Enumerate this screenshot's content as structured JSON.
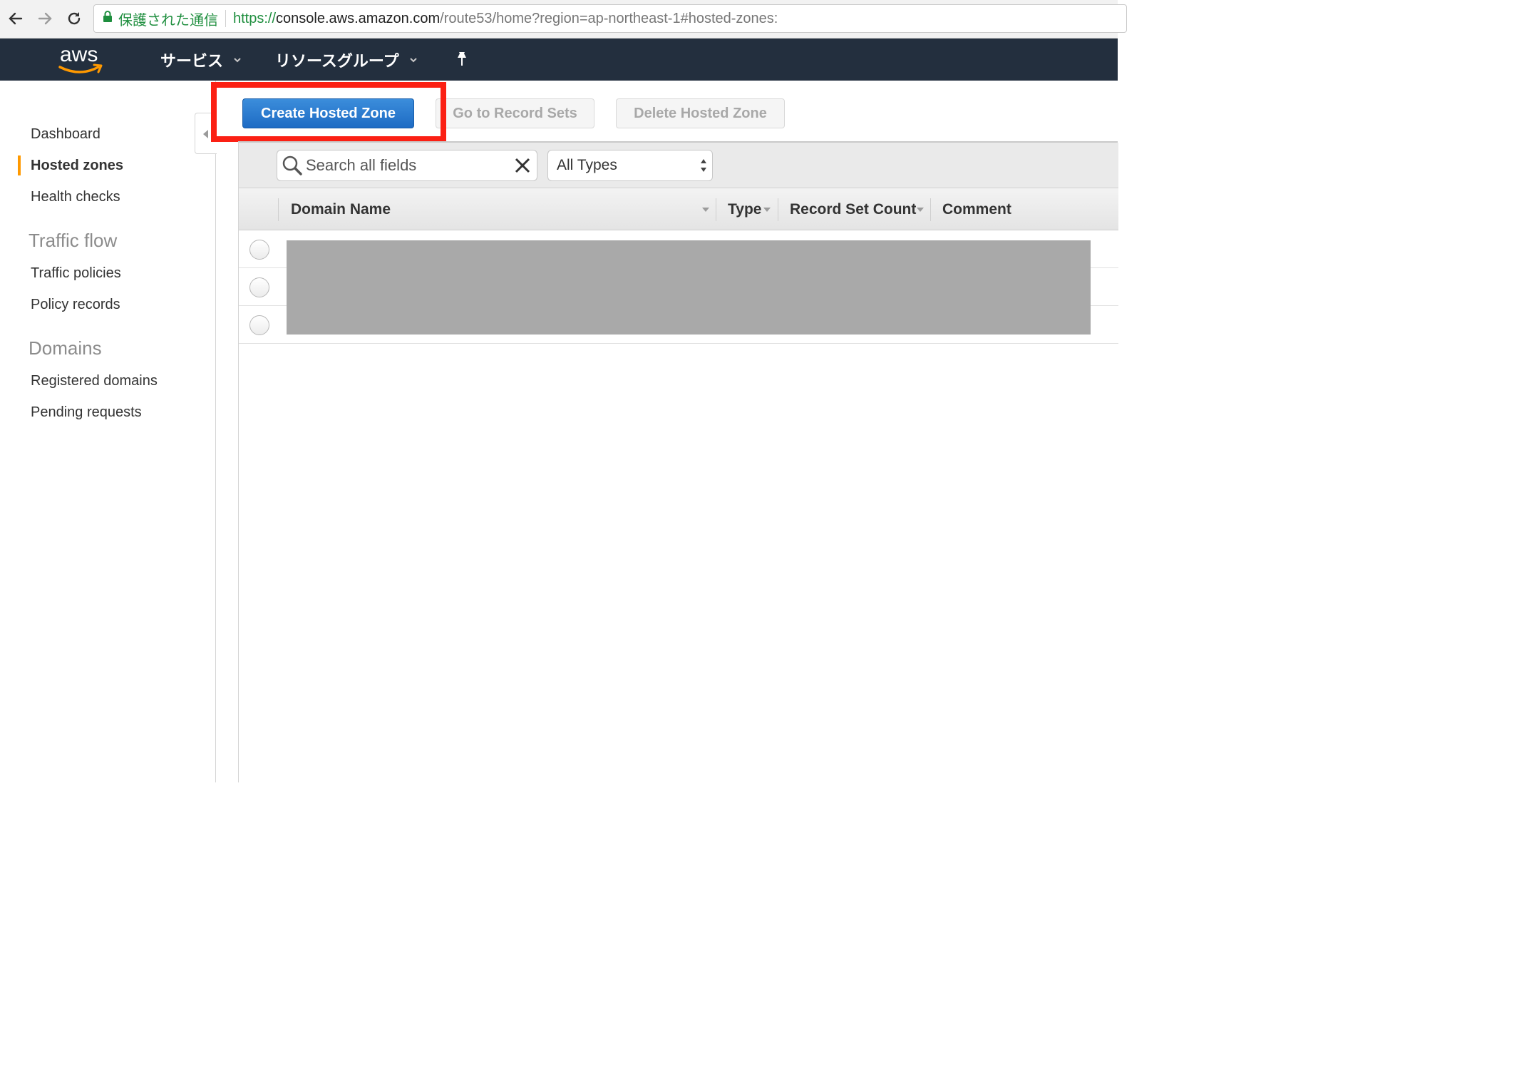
{
  "browser": {
    "secure_label": "保護された通信",
    "url_scheme": "https://",
    "url_host": "console.aws.amazon.com",
    "url_path": "/route53/home?region=ap-northeast-1#hosted-zones:"
  },
  "header": {
    "logo": "aws",
    "menu_services": "サービス",
    "menu_resource_groups": "リソースグループ"
  },
  "sidebar": {
    "dashboard": "Dashboard",
    "hosted_zones": "Hosted zones",
    "health_checks": "Health checks",
    "section_traffic_flow": "Traffic flow",
    "traffic_policies": "Traffic policies",
    "policy_records": "Policy records",
    "section_domains": "Domains",
    "registered_domains": "Registered domains",
    "pending_requests": "Pending requests"
  },
  "toolbar": {
    "create_label": "Create Hosted Zone",
    "goto_label": "Go to Record Sets",
    "delete_label": "Delete Hosted Zone"
  },
  "filter": {
    "search_placeholder": "Search all fields",
    "type_selected": "All Types"
  },
  "table": {
    "columns": [
      "Domain Name",
      "Type",
      "Record Set Count",
      "Comment"
    ],
    "row_count": 3
  },
  "colors": {
    "header_bg": "#232f3e",
    "accent_orange": "#ff9900",
    "primary_button": "#1e6bc4",
    "highlight": "#fb2014"
  }
}
